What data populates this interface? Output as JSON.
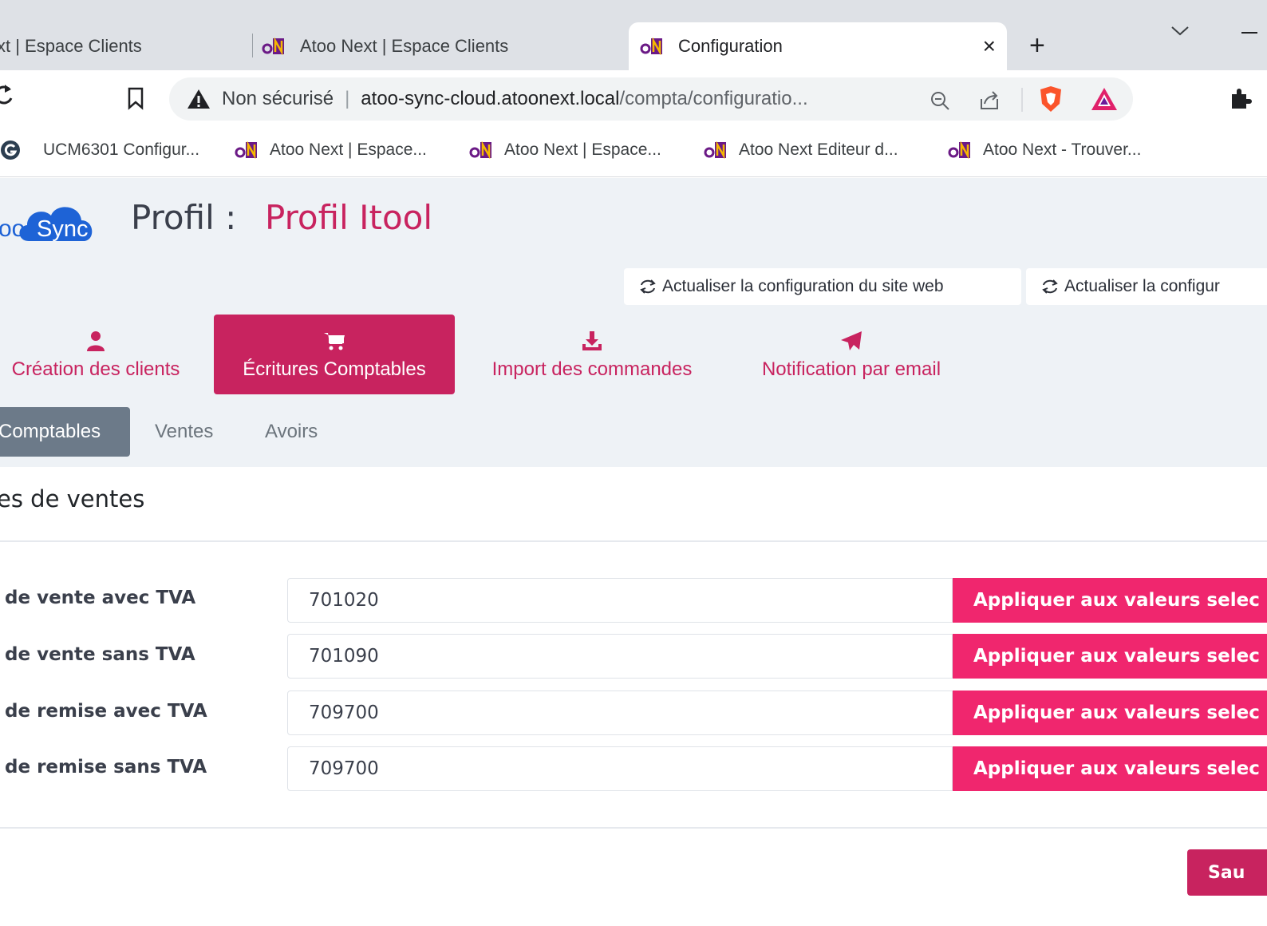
{
  "browser": {
    "tabs": [
      {
        "title": "xt | Espace Clients",
        "active": false
      },
      {
        "title": "Atoo Next | Espace Clients",
        "active": false
      },
      {
        "title": "Configuration",
        "active": true
      }
    ],
    "new_tab_label": "+",
    "close_label": "×",
    "address": {
      "security_label": "Non sécurisé",
      "separator": "|",
      "host": "atoo-sync-cloud.atoonext.local",
      "path": "/compta/configuratio..."
    },
    "bookmarks": [
      {
        "label": "UCM6301 Configur...",
        "icon": "grandstream-icon"
      },
      {
        "label": "Atoo Next | Espace...",
        "icon": "atoonext-icon"
      },
      {
        "label": "Atoo Next | Espace...",
        "icon": "atoonext-icon"
      },
      {
        "label": "Atoo Next Editeur d...",
        "icon": "atoonext-icon"
      },
      {
        "label": "Atoo Next - Trouver...",
        "icon": "atoonext-icon"
      }
    ]
  },
  "page": {
    "logo_text_left": "oo",
    "logo_text_cloud": "Sync",
    "profile_label": "Profil :",
    "profile_name": "Profil Itool",
    "refresh_buttons": [
      "Actualiser la configuration du site web",
      "Actualiser la configur"
    ],
    "main_tabs": [
      {
        "label": "Création des clients",
        "icon": "user-icon",
        "active": false
      },
      {
        "label": "Écritures Comptables",
        "icon": "cart-icon",
        "active": true
      },
      {
        "label": "Import des commandes",
        "icon": "download-icon",
        "active": false
      },
      {
        "label": "Notification par email",
        "icon": "paper-plane-icon",
        "active": false
      }
    ],
    "sub_tabs": [
      {
        "label": "Comptables",
        "active": true
      },
      {
        "label": "Ventes",
        "active": false
      },
      {
        "label": "Avoirs",
        "active": false
      }
    ],
    "section_title": "es de ventes",
    "form_rows": [
      {
        "label": "de vente avec TVA",
        "value": "701020",
        "apply_label": "Appliquer aux valeurs selec"
      },
      {
        "label": "de vente sans TVA",
        "value": "701090",
        "apply_label": "Appliquer aux valeurs selec"
      },
      {
        "label": "de remise avec TVA",
        "value": "709700",
        "apply_label": "Appliquer aux valeurs selec"
      },
      {
        "label": "de remise sans TVA",
        "value": "709700",
        "apply_label": "Appliquer aux valeurs selec"
      }
    ],
    "save_label": "Sau"
  },
  "colors": {
    "brand_primary": "#c8235f",
    "apply_button": "#f0266e",
    "subtab_active": "#6c7a89",
    "page_header_bg": "#eef2f6"
  }
}
